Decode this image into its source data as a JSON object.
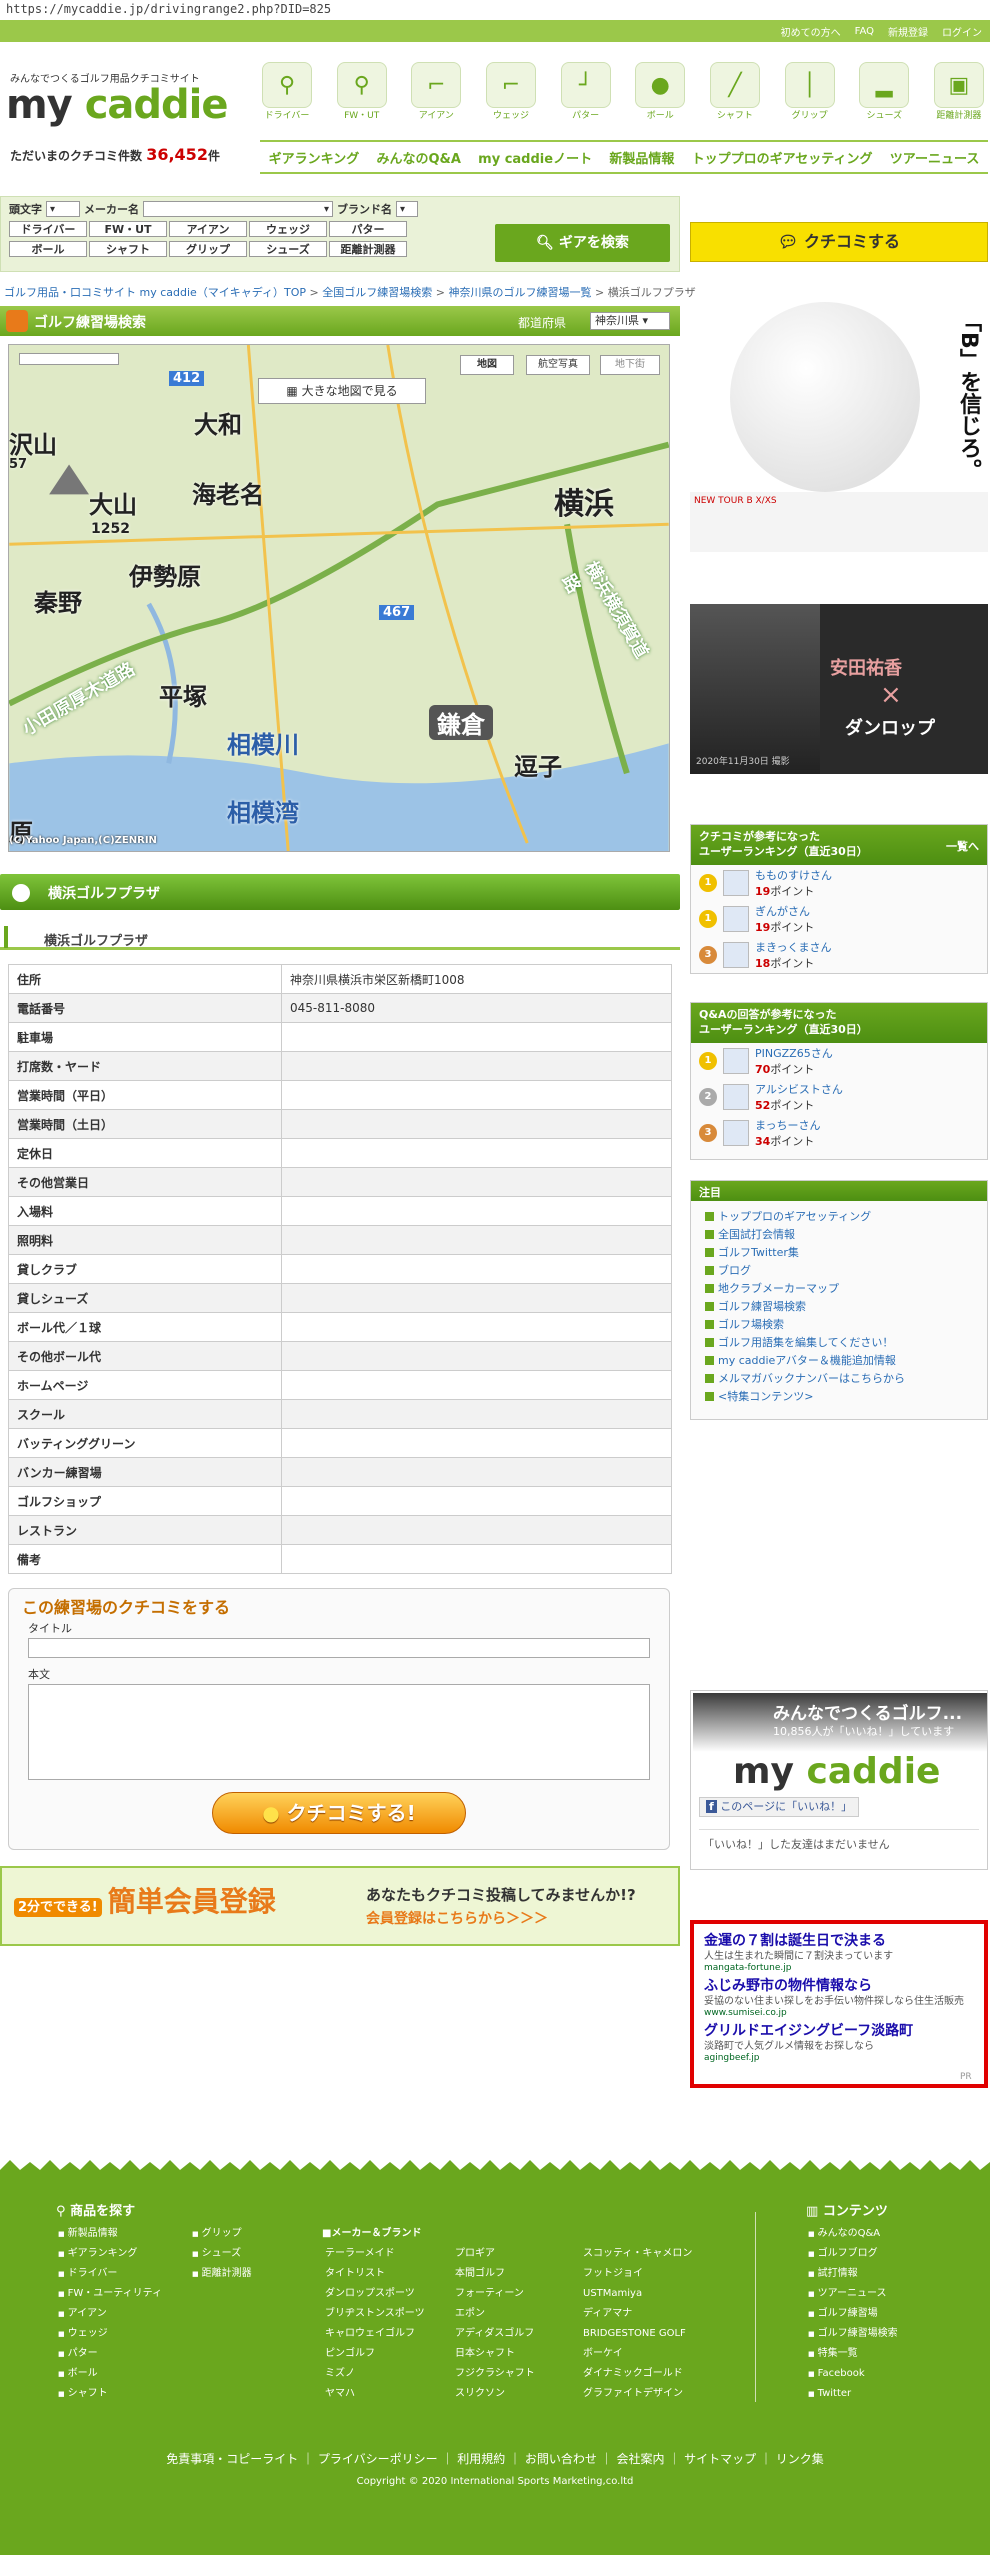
{
  "url": "https://mycaddie.jp/drivingrange2.php?DID=825",
  "topbar": {
    "links": [
      "初めての方へ",
      "FAQ",
      "新規登録",
      "ログイン"
    ]
  },
  "header": {
    "tagline": "みんなでつくるゴルフ用品クチコミサイト",
    "logo_my": "my",
    "logo_caddie": "caddie",
    "count_label": "ただいまのクチコミ件数",
    "count_value": "36,452",
    "count_unit": "件",
    "categories": [
      "ドライバー",
      "FW・UT",
      "アイアン",
      "ウェッジ",
      "パター",
      "ボール",
      "シャフト",
      "グリップ",
      "シューズ",
      "距離計測器"
    ],
    "nav": [
      "ギアランキング",
      "みんなのQ&A",
      "my caddieノート",
      "新製品情報",
      "トッププロのギアセッティング",
      "ツアーニュース"
    ]
  },
  "search": {
    "label_initial": "頭文字",
    "label_maker": "メーカー名",
    "label_brand": "ブランド名",
    "buttons_row1": [
      "ドライバー",
      "FW・UT",
      "アイアン",
      "ウェッジ",
      "パター"
    ],
    "buttons_row2": [
      "ボール",
      "シャフト",
      "グリップ",
      "シューズ",
      "距離計測器"
    ],
    "submit": "ギアを検索"
  },
  "kuchikomi_button": "クチコミする",
  "breadcrumb": [
    "ゴルフ用品・口コミサイト my caddie（マイキャディ）TOP",
    "全国ゴルフ練習場検索",
    "神奈川県のゴルフ練習場一覧",
    "横浜ゴルフプラザ"
  ],
  "map": {
    "title": "ゴルフ練習場検索",
    "pref_label": "都道府県",
    "pref_value": "神奈川県",
    "big_map": "大きな地図で見る",
    "types": [
      "地図",
      "航空写真",
      "地下街"
    ],
    "places": [
      "大和",
      "海老名",
      "横浜",
      "大山",
      "1252",
      "伊勢原",
      "秦野",
      "平塚",
      "相模川",
      "鎌倉",
      "逗子",
      "相模湾",
      "小田原厚木道路",
      "横浜横須賀道路",
      "沢山",
      "原",
      "467",
      "412",
      "57"
    ],
    "credit": "(C)Yahoo Japan,(C)ZENRIN"
  },
  "range": {
    "name": "横浜ゴルフプラザ",
    "rows": [
      {
        "k": "住所",
        "v": "神奈川県横浜市栄区新橋町1008"
      },
      {
        "k": "電話番号",
        "v": "045-811-8080"
      },
      {
        "k": "駐車場",
        "v": ""
      },
      {
        "k": "打席数・ヤード",
        "v": ""
      },
      {
        "k": "営業時間（平日）",
        "v": ""
      },
      {
        "k": "営業時間（土日）",
        "v": ""
      },
      {
        "k": "定休日",
        "v": ""
      },
      {
        "k": "その他営業日",
        "v": ""
      },
      {
        "k": "入場料",
        "v": ""
      },
      {
        "k": "照明料",
        "v": ""
      },
      {
        "k": "貸しクラブ",
        "v": ""
      },
      {
        "k": "貸しシューズ",
        "v": ""
      },
      {
        "k": "ボール代／１球",
        "v": ""
      },
      {
        "k": "その他ボール代",
        "v": ""
      },
      {
        "k": "ホームページ",
        "v": ""
      },
      {
        "k": "スクール",
        "v": ""
      },
      {
        "k": "バッティンググリーン",
        "v": ""
      },
      {
        "k": "バンカー練習場",
        "v": ""
      },
      {
        "k": "ゴルフショップ",
        "v": ""
      },
      {
        "k": "レストラン",
        "v": ""
      },
      {
        "k": "備考",
        "v": ""
      }
    ]
  },
  "review": {
    "heading": "この練習場のクチコミをする",
    "title_label": "タイトル",
    "body_label": "本文",
    "submit": "クチコミする!"
  },
  "banner": {
    "badge": "2分でできる!",
    "title": "簡単会員登録",
    "line1": "あなたもクチコミ投稿してみませんか!?",
    "line2": "会員登録はこちらから＞＞＞"
  },
  "ads": {
    "ad1_text": "「B」を信じろ。",
    "ad1_foot": "NEW TOUR B X/XS",
    "ad2_name": "安田祐香",
    "ad2_x": "×",
    "ad2_brand": "ダンロップ",
    "ad2_date": "2020年11月30日 撮影"
  },
  "ranking1": {
    "title1": "クチコミが参考になった",
    "title2": "ユーザーランキング（直近30日）",
    "more": "一覧へ",
    "items": [
      {
        "rank": "1",
        "name": "もものすけさん",
        "pts": "19",
        "unit": "ポイント"
      },
      {
        "rank": "1",
        "name": "ぎんがさん",
        "pts": "19",
        "unit": "ポイント"
      },
      {
        "rank": "3",
        "name": "まきっくまさん",
        "pts": "18",
        "unit": "ポイント"
      }
    ]
  },
  "ranking2": {
    "title1": "Q&Aの回答が参考になった",
    "title2": "ユーザーランキング（直近30日）",
    "items": [
      {
        "rank": "1",
        "name": "PINGZZ65さん",
        "pts": "70",
        "unit": "ポイント"
      },
      {
        "rank": "2",
        "name": "アルシビストさん",
        "pts": "52",
        "unit": "ポイント"
      },
      {
        "rank": "3",
        "name": "まっちーさん",
        "pts": "34",
        "unit": "ポイント"
      }
    ]
  },
  "notice": {
    "title": "注目",
    "items": [
      "トッププロのギアセッティング",
      "全国試打会情報",
      "ゴルフTwitter集",
      "ブログ",
      "地クラブメーカーマップ",
      "ゴルフ練習場検索",
      "ゴルフ場検索",
      "ゴルフ用語集を編集してください！",
      "my caddieアバター＆機能追加情報",
      "メルマガバックナンバーはこちらから",
      "<特集コンテンツ>"
    ]
  },
  "facebook": {
    "title": "みんなでつくるゴルフ...",
    "count": "10,856人が「いいね！」しています",
    "like": "このページに「いいね！」",
    "none": "「いいね！」した友達はまだいません"
  },
  "textads": [
    {
      "t": "金運の７割は誕生日で決まる",
      "d": "人生は生まれた瞬間に７割決まっています",
      "u": "mangata-fortune.jp"
    },
    {
      "t": "ふじみ野市の物件情報なら",
      "d": "妥協のない住まい探しをお手伝い物件探しなら住生活販売",
      "u": "www.sumisei.co.jp"
    },
    {
      "t": "グリルドエイジングビーフ淡路町",
      "d": "淡路町で人気グルメ情報をお探しなら",
      "u": "agingbeef.jp"
    }
  ],
  "pr": "PR",
  "footer": {
    "products_head": "商品を探す",
    "contents_head": "コンテンツ",
    "col1": [
      "新製品情報",
      "ギアランキング",
      "ドライバー",
      "FW・ユーティリティ",
      "アイアン",
      "ウェッジ",
      "パター",
      "ボール",
      "シャフト"
    ],
    "col2": [
      "グリップ",
      "シューズ",
      "距離計測器"
    ],
    "makers_head": "メーカー＆ブランド",
    "col3": [
      "テーラーメイド",
      "タイトリスト",
      "ダンロップスポーツ",
      "ブリヂストンスポーツ",
      "キャロウェイゴルフ",
      "ピンゴルフ",
      "ミズノ",
      "ヤマハ"
    ],
    "col4": [
      "プロギア",
      "本間ゴルフ",
      "フォーティーン",
      "エポン",
      "アディダスゴルフ",
      "日本シャフト",
      "フジクラシャフト",
      "スリクソン"
    ],
    "col5": [
      "スコッティ・キャメロン",
      "フットジョイ",
      "USTMamiya",
      "ディアマナ",
      "BRIDGESTONE GOLF",
      "ボーケイ",
      "ダイナミックゴールド",
      "グラファイトデザイン"
    ],
    "col6": [
      "みんなのQ&A",
      "ゴルフブログ",
      "試打情報",
      "ツアーニュース",
      "ゴルフ練習場",
      "ゴルフ練習場検索",
      "特集一覧",
      "Facebook",
      "Twitter"
    ],
    "links": "免責事項・コピーライト ｜ プライバシーポリシー ｜ 利用規約 ｜ お問い合わせ ｜ 会社案内 ｜ サイトマップ ｜ リンク集",
    "copyright": "Copyright © 2020 International Sports Marketing,co.ltd"
  }
}
